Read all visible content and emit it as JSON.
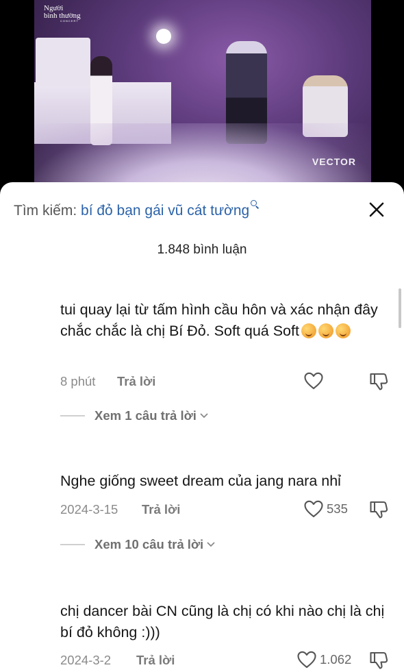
{
  "video": {
    "logo_line1": "Người",
    "logo_line2": "bình thường",
    "logo_sub": "CONCERT",
    "logo_right": "VECTOR"
  },
  "search": {
    "label": "Tìm kiếm:",
    "query": "bí đỏ bạn gái vũ cát tường"
  },
  "comment_count": "1.848 bình luận",
  "reply_label": "Trả lời",
  "comments": [
    {
      "text": "tui quay lại từ tấm hình cầu hôn và xác nhận đây chắc chắc là chị Bí Đỏ. Soft quá Soft",
      "time": "8 phút",
      "likes": "",
      "view_replies": "Xem 1 câu trả lời"
    },
    {
      "text": "Nghe giống sweet dream của jang nara nhỉ",
      "time": "2024-3-15",
      "likes": "535",
      "view_replies": "Xem 10 câu trả lời"
    },
    {
      "text": "chị dancer bài CN cũng là chị có khi nào chị là chị bí đỏ không :)))",
      "time": "2024-3-2",
      "likes": "1.062",
      "view_replies": ""
    }
  ]
}
